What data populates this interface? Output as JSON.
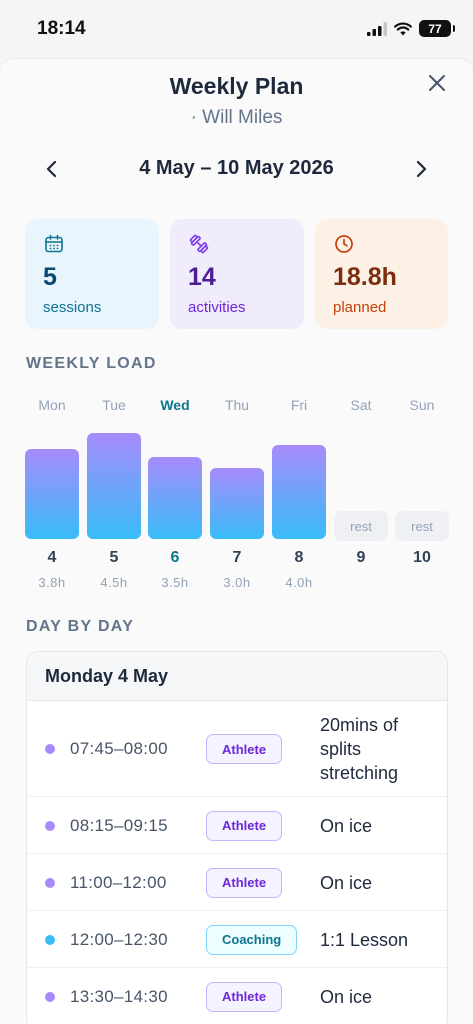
{
  "status_bar": {
    "time": "18:14",
    "battery": "77"
  },
  "header": {
    "title": "Weekly Plan",
    "subtitle": "· Will Miles"
  },
  "week_nav": {
    "label": "4 May – 10 May 2026"
  },
  "summary": {
    "sessions": {
      "value": "5",
      "label": "sessions",
      "icon": "calendar-icon"
    },
    "activities": {
      "value": "14",
      "label": "activities",
      "icon": "dumbbell-icon"
    },
    "planned": {
      "value": "18.8h",
      "label": "planned",
      "icon": "clock-icon"
    }
  },
  "weekly_load": {
    "title": "WEEKLY LOAD",
    "days": [
      {
        "name": "Mon",
        "num": "4",
        "hours": "3.8h",
        "value": 3.8,
        "rest": false,
        "today": false
      },
      {
        "name": "Tue",
        "num": "5",
        "hours": "4.5h",
        "value": 4.5,
        "rest": false,
        "today": false
      },
      {
        "name": "Wed",
        "num": "6",
        "hours": "3.5h",
        "value": 3.5,
        "rest": false,
        "today": true
      },
      {
        "name": "Thu",
        "num": "7",
        "hours": "3.0h",
        "value": 3.0,
        "rest": false,
        "today": false
      },
      {
        "name": "Fri",
        "num": "8",
        "hours": "4.0h",
        "value": 4.0,
        "rest": false,
        "today": false
      },
      {
        "name": "Sat",
        "num": "9",
        "hours": "",
        "value": 0,
        "rest": true,
        "rest_label": "rest",
        "today": false
      },
      {
        "name": "Sun",
        "num": "10",
        "hours": "",
        "value": 0,
        "rest": true,
        "rest_label": "rest",
        "today": false
      }
    ]
  },
  "day_by_day": {
    "title": "DAY BY DAY",
    "day": "Monday 4 May",
    "activities": [
      {
        "time": "07:45–08:00",
        "tag": "Athlete",
        "type": "athlete",
        "title": "20mins of splits stretching"
      },
      {
        "time": "08:15–09:15",
        "tag": "Athlete",
        "type": "athlete",
        "title": "On ice"
      },
      {
        "time": "11:00–12:00",
        "tag": "Athlete",
        "type": "athlete",
        "title": "On ice"
      },
      {
        "time": "12:00–12:30",
        "tag": "Coaching",
        "type": "coaching",
        "title": "1:1 Lesson"
      },
      {
        "time": "13:30–14:30",
        "tag": "Athlete",
        "type": "athlete",
        "title": "On ice"
      }
    ]
  },
  "colors": {
    "athlete": "#a78bfa",
    "coaching": "#38bdf8"
  }
}
